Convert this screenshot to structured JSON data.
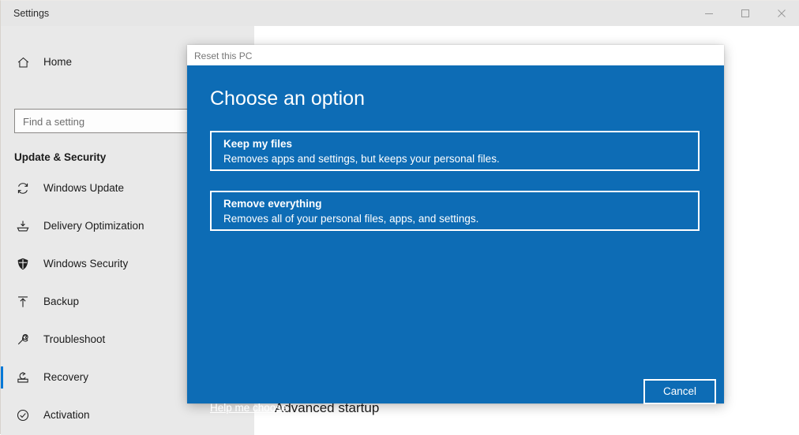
{
  "window": {
    "title": "Settings",
    "controls": {
      "minimize": "minimize-icon",
      "maximize": "maximize-icon",
      "close": "close-icon"
    }
  },
  "sidebar": {
    "home": {
      "label": "Home",
      "icon": "home-icon"
    },
    "search": {
      "placeholder": "Find a setting",
      "value": ""
    },
    "category": "Update & Security",
    "items": [
      {
        "label": "Windows Update",
        "icon": "refresh-icon",
        "selected": false
      },
      {
        "label": "Delivery Optimization",
        "icon": "delivery-icon",
        "selected": false
      },
      {
        "label": "Windows Security",
        "icon": "shield-icon",
        "selected": false
      },
      {
        "label": "Backup",
        "icon": "upload-arrow-icon",
        "selected": false
      },
      {
        "label": "Troubleshoot",
        "icon": "wrench-icon",
        "selected": false
      },
      {
        "label": "Recovery",
        "icon": "recovery-icon",
        "selected": true
      },
      {
        "label": "Activation",
        "icon": "check-circle-icon",
        "selected": false
      }
    ]
  },
  "content": {
    "heading": "Advanced startup"
  },
  "dialog": {
    "title": "Reset this PC",
    "heading": "Choose an option",
    "options": [
      {
        "title": "Keep my files",
        "description": "Removes apps and settings, but keeps your personal files."
      },
      {
        "title": "Remove everything",
        "description": "Removes all of your personal files, apps, and settings."
      }
    ],
    "help_link": "Help me choose",
    "cancel_label": "Cancel"
  },
  "colors": {
    "dialog_blue": "#0d6cb5",
    "accent_blue": "#0078d7",
    "sidebar_bg": "#e9e9e9",
    "titlebar_bg": "#e6e6e6"
  }
}
